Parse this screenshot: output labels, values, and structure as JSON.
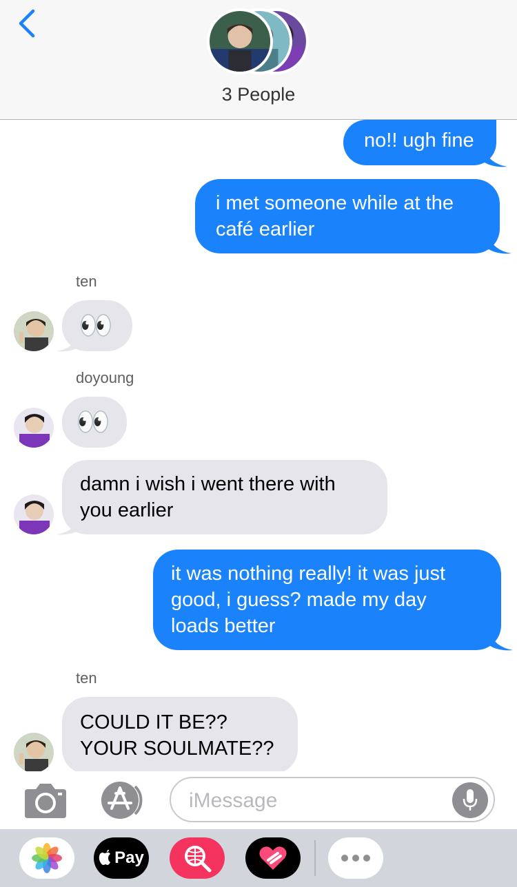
{
  "header": {
    "back_icon": "chevron-left-icon",
    "group_label": "3 People",
    "accent_color": "#1a82fb"
  },
  "messages": [
    {
      "direction": "sent",
      "lines": [
        "no!! ugh fine"
      ]
    },
    {
      "direction": "sent",
      "lines": [
        "i met someone while at the",
        "café earlier"
      ]
    },
    {
      "direction": "received",
      "sender": "ten",
      "emoji": "👀"
    },
    {
      "direction": "received",
      "sender": "doyoung",
      "emoji": "👀"
    },
    {
      "direction": "received",
      "lines": [
        "damn i wish i went there with",
        "you earlier"
      ]
    },
    {
      "direction": "sent",
      "lines": [
        "it was nothing really! it was just",
        "good, i guess? made my day",
        "loads better"
      ]
    },
    {
      "direction": "received",
      "sender": "ten",
      "lines": [
        "COULD IT BE??",
        "YOUR SOULMATE??"
      ]
    }
  ],
  "input": {
    "placeholder": "iMessage",
    "camera_icon": "camera-icon",
    "appstore_icon": "app-store-icon",
    "mic_icon": "microphone-icon"
  },
  "app_drawer": {
    "items": [
      {
        "name": "photos-icon",
        "label": ""
      },
      {
        "name": "apple-pay-icon",
        "label": "Pay"
      },
      {
        "name": "web-search-icon",
        "label": ""
      },
      {
        "name": "digital-touch-icon",
        "label": ""
      },
      {
        "name": "more-apps-icon",
        "label": ""
      }
    ]
  },
  "colors": {
    "sent_bubble": "#1a82fb",
    "received_bubble": "#e6e5eb",
    "drawer_bg": "#d2d5db"
  }
}
